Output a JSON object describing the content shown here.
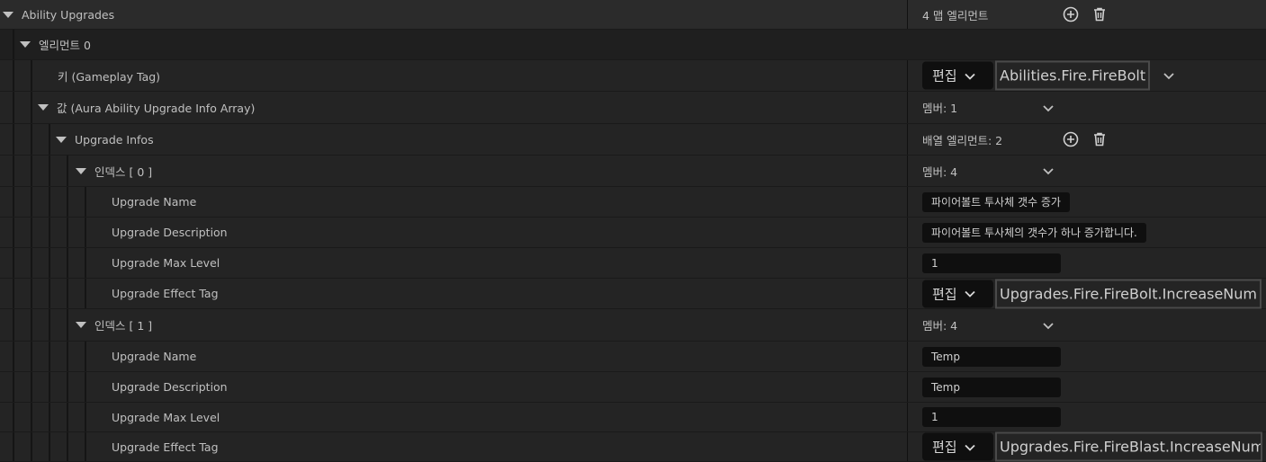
{
  "section": {
    "title": "Ability Upgrades",
    "count_label": "4 맵 엘리먼트"
  },
  "element": {
    "label": "엘리먼트 0"
  },
  "key_row": {
    "label": "키 (Gameplay Tag)",
    "edit_label": "편집",
    "tag_value": "Abilities.Fire.FireBolt"
  },
  "value_row": {
    "label": "값 (Aura Ability Upgrade Info Array)",
    "members_label": "멤버: 1"
  },
  "upgrade_infos": {
    "label": "Upgrade Infos",
    "count_label": "배열 엘리먼트: 2"
  },
  "indices": [
    {
      "label": "인덱스 [ 0 ]",
      "members_label": "멤버: 4",
      "name_label": "Upgrade Name",
      "name_value": "파이어볼트 투사체 갯수 증가",
      "desc_label": "Upgrade Description",
      "desc_value": "파이어볼트 투사체의 갯수가 하나 증가합니다.",
      "level_label": "Upgrade Max Level",
      "level_value": "1",
      "tag_label": "Upgrade Effect Tag",
      "edit_label": "편집",
      "tag_value": "Upgrades.Fire.FireBolt.IncreaseNum"
    },
    {
      "label": "인덱스 [ 1 ]",
      "members_label": "멤버: 4",
      "name_label": "Upgrade Name",
      "name_value": "Temp",
      "desc_label": "Upgrade Description",
      "desc_value": "Temp",
      "level_label": "Upgrade Max Level",
      "level_value": "1",
      "tag_label": "Upgrade Effect Tag",
      "edit_label": "편집",
      "tag_value": "Upgrades.Fire.FireBlast.IncreaseNum"
    }
  ],
  "icons": {
    "add": "add-circle-icon",
    "delete": "trash-icon",
    "expand": "expand-triangle-icon",
    "dropdown": "chevron-down-icon"
  },
  "colors": {
    "background": "#1a1a1a",
    "row": "#242424",
    "header_row": "#2b2b2b",
    "text": "#c0c0c0",
    "input": "#0f0f0f"
  }
}
